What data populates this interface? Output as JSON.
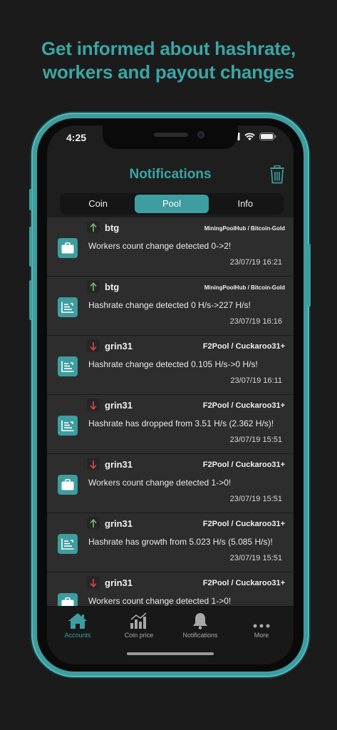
{
  "headline": {
    "line1": "Get informed about hashrate,",
    "line2": "workers and payout changes"
  },
  "status_bar": {
    "time": "4:25"
  },
  "header": {
    "title": "Notifications",
    "trash_icon": "trash-icon"
  },
  "segments": [
    {
      "label": "Coin",
      "active": false
    },
    {
      "label": "Pool",
      "active": true
    },
    {
      "label": "Info",
      "active": false
    }
  ],
  "notifications": [
    {
      "icon": "briefcase-icon",
      "direction": "up",
      "coin": "btg",
      "pool": "MiningPoolHub / Bitcoin-Gold",
      "message": "Workers count change detected 0->2!",
      "date": "23/07/19 16:21"
    },
    {
      "icon": "chart-icon",
      "direction": "up",
      "coin": "btg",
      "pool": "MiningPoolHub / Bitcoin-Gold",
      "message": "Hashrate change detected 0 H/s->227 H/s!",
      "date": "23/07/19 16:16"
    },
    {
      "icon": "chart-icon",
      "direction": "down",
      "coin": "grin31",
      "pool": "F2Pool / Cuckaroo31+",
      "message": "Hashrate change detected 0.105 H/s->0 H/s!",
      "date": "23/07/19 16:11"
    },
    {
      "icon": "chart-icon",
      "direction": "down",
      "coin": "grin31",
      "pool": "F2Pool / Cuckaroo31+",
      "message": "Hashrate has dropped from 3.51 H/s (2.362 H/s)!",
      "date": "23/07/19 15:51"
    },
    {
      "icon": "briefcase-icon",
      "direction": "down",
      "coin": "grin31",
      "pool": "F2Pool / Cuckaroo31+",
      "message": "Workers count change detected 1->0!",
      "date": "23/07/19 15:51"
    },
    {
      "icon": "chart-icon",
      "direction": "up",
      "coin": "grin31",
      "pool": "F2Pool / Cuckaroo31+",
      "message": "Hashrate has growth from 5.023 H/s (5.085 H/s)!",
      "date": "23/07/19 15:51"
    },
    {
      "icon": "briefcase-icon",
      "direction": "down",
      "coin": "grin31",
      "pool": "F2Pool / Cuckaroo31+",
      "message": "Workers count change detected 1->0!",
      "date": ""
    }
  ],
  "tabs": [
    {
      "label": "Accounts",
      "icon": "home-icon",
      "active": true
    },
    {
      "label": "Coin price",
      "icon": "bar-chart-icon",
      "active": false
    },
    {
      "label": "Notifications",
      "icon": "bell-icon",
      "active": false
    },
    {
      "label": "More",
      "icon": "more-icon",
      "active": false
    }
  ],
  "colors": {
    "accent": "#3d9d9f",
    "up": "#6dc06d",
    "down": "#e0453f",
    "background": "#1b1b1b"
  }
}
